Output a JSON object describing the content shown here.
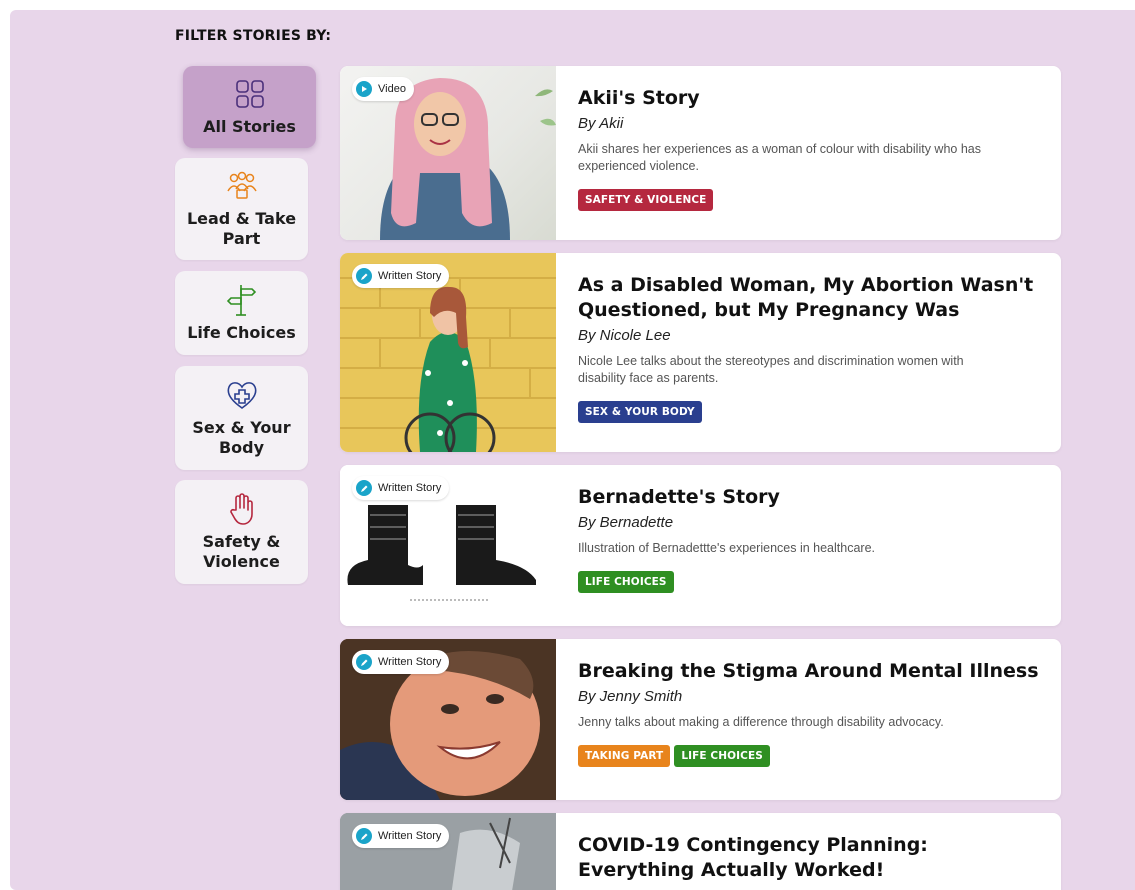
{
  "filter_heading": "FILTER STORIES BY:",
  "filters": [
    {
      "label": "All Stories",
      "icon": "grid-icon",
      "active": true
    },
    {
      "label": "Lead & Take Part",
      "icon": "people-group-icon",
      "active": false
    },
    {
      "label": "Life Choices",
      "icon": "signpost-icon",
      "active": false
    },
    {
      "label": "Sex & Your Body",
      "icon": "heart-plus-icon",
      "active": false
    },
    {
      "label": "Safety & Violence",
      "icon": "raised-hand-icon",
      "active": false
    }
  ],
  "tag_colors": {
    "safety_violence": "#b5283f",
    "sex_body": "#2a3f8f",
    "life_choices": "#2f8f22",
    "taking_part": "#e8841c"
  },
  "accent_color": "#1aa4c9",
  "stories": [
    {
      "media_type": "Video",
      "media_icon": "play-icon",
      "title": "Akii's Story",
      "author": "By Akii",
      "description": "Akii shares her experiences as a woman of colour with disability who has experienced violence.",
      "tags": [
        {
          "label": "SAFETY & VIOLENCE",
          "color": "#b5283f"
        }
      ]
    },
    {
      "media_type": "Written Story",
      "media_icon": "pencil-icon",
      "title": "As a Disabled Woman, My Abortion Wasn't Questioned, but My Pregnancy Was",
      "author": "By Nicole Lee",
      "description": "Nicole Lee talks about the stereotypes and discrimination women with disability face as parents.",
      "tags": [
        {
          "label": "SEX & YOUR BODY",
          "color": "#2a3f8f"
        }
      ]
    },
    {
      "media_type": "Written Story",
      "media_icon": "pencil-icon",
      "title": "Bernadette's Story",
      "author": "By Bernadette",
      "description": "Illustration of Bernadettte's experiences in healthcare.",
      "tags": [
        {
          "label": "LIFE CHOICES",
          "color": "#2f8f22"
        }
      ]
    },
    {
      "media_type": "Written Story",
      "media_icon": "pencil-icon",
      "title": "Breaking the Stigma Around Mental Illness",
      "author": "By Jenny Smith",
      "description": "Jenny talks about making a difference through disability advocacy.",
      "tags": [
        {
          "label": "TAKING PART",
          "color": "#e8841c"
        },
        {
          "label": "LIFE CHOICES",
          "color": "#2f8f22"
        }
      ]
    },
    {
      "media_type": "Written Story",
      "media_icon": "pencil-icon",
      "title": "COVID-19 Contingency Planning: Everything Actually Worked!",
      "author": "",
      "description": "",
      "tags": []
    }
  ]
}
